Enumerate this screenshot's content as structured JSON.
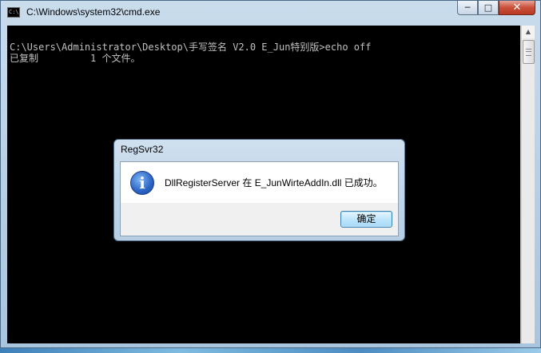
{
  "cmd_window": {
    "title": "C:\\Windows\\system32\\cmd.exe",
    "icon_text": "C:\\",
    "buttons": {
      "minimize": "─",
      "maximize": "□",
      "close": "✕"
    },
    "console_lines": [
      "C:\\Users\\Administrator\\Desktop\\手写签名 V2.0 E_Jun特别版>echo off",
      "已复制         1 个文件。"
    ],
    "scroll_up": "▲"
  },
  "dialog": {
    "title": "RegSvr32",
    "icon": "information-icon",
    "icon_glyph": "i",
    "message": "DllRegisterServer 在 E_JunWirteAddIn.dll 已成功。",
    "ok_label": "确定"
  },
  "colors": {
    "console_bg": "#000000",
    "console_text": "#c0c0c0",
    "close_button": "#c8503a",
    "desktop": "#6aa9d6"
  }
}
